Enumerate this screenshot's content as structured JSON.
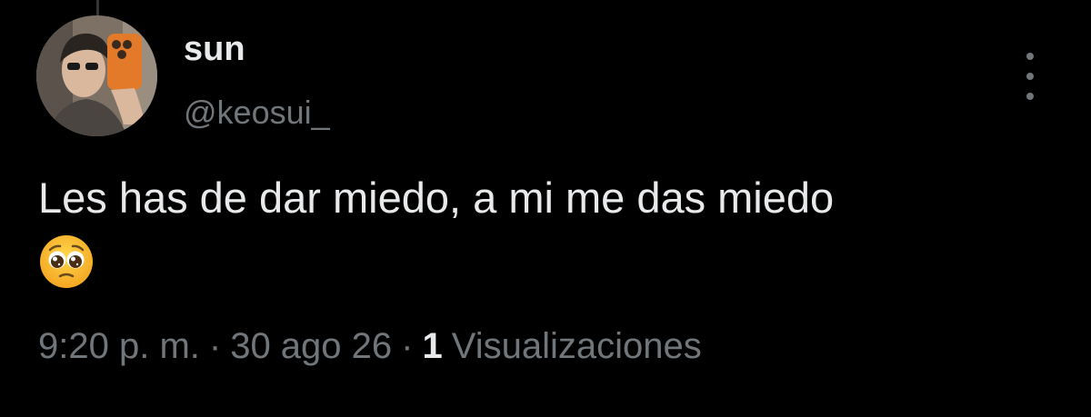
{
  "tweet": {
    "author": {
      "display_name": "sun",
      "handle": "@keosui_",
      "avatar_icon": "profile-photo"
    },
    "text": "Les has de dar miedo, a mi me das miedo",
    "emoji": "pleading-face-emoji",
    "meta": {
      "time": "9:20 p. m.",
      "separator": "·",
      "date": "30 ago 26",
      "views_count": "1",
      "views_label": "Visualizaciones"
    },
    "more_icon": "more-options-icon"
  },
  "colors": {
    "background": "#000000",
    "primary_text": "#e7e9ea",
    "secondary_text": "#71767b"
  }
}
